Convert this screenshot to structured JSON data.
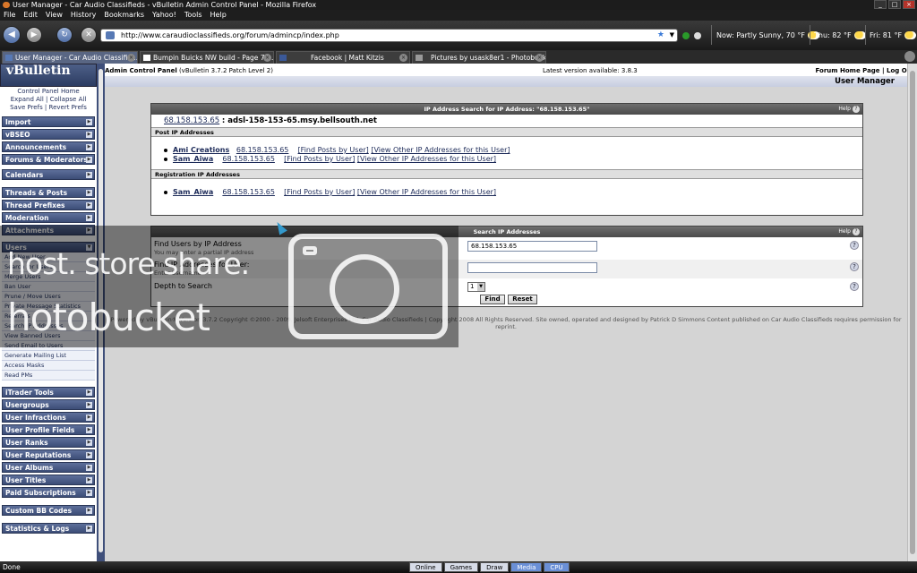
{
  "window": {
    "title": "User Manager - Car Audio Classifieds - vBulletin Admin Control Panel - Mozilla Firefox"
  },
  "menu": [
    "File",
    "Edit",
    "View",
    "History",
    "Bookmarks",
    "Yahoo!",
    "Tools",
    "Help"
  ],
  "url": "http://www.caraudioclassifieds.org/forum/admincp/index.php",
  "weather": {
    "now": "Now: Partly Sunny, 70 °F",
    "thu": "Thu: 82 °F",
    "fri": "Fri: 81 °F"
  },
  "tabs": [
    {
      "label": "User Manager - Car Audio Classifie...",
      "active": true
    },
    {
      "label": "Bumpin Buicks NW build - Page 7 -...",
      "active": false
    },
    {
      "label": "Facebook | Matt Kitzis",
      "active": false
    },
    {
      "label": "Pictures by usask8er1 - Photobucket",
      "active": false
    }
  ],
  "sidebar": {
    "logo": "vBulletin",
    "links": [
      "Control Panel Home",
      "Expand All | Collapse All",
      "Save Prefs | Revert Prefs"
    ],
    "groups_top": [
      "Import",
      "vBSEO",
      "Announcements",
      "Forums & Moderators",
      "Calendars",
      "Threads & Posts",
      "Thread Prefixes",
      "Moderation",
      "Attachments"
    ],
    "users_group": "Users",
    "users_items": [
      "Add New User",
      "Search for Users",
      "Merge Users",
      "Ban User",
      "Prune / Move Users",
      "Private Message Statistics",
      "Referrals",
      "Search IP Addresses",
      "View Banned Users",
      "Send Email to Users",
      "Generate Mailing List",
      "Access Masks",
      "Read PMs"
    ],
    "groups_bottom": [
      "iTrader Tools",
      "Usergroups",
      "User Infractions",
      "User Profile Fields",
      "User Ranks",
      "User Reputations",
      "User Albums",
      "User Titles",
      "Paid Subscriptions",
      "Custom BB Codes",
      "Statistics & Logs"
    ]
  },
  "header": {
    "acp": "Admin Control Panel",
    "version": "(vBulletin 3.7.2 Patch Level 2)",
    "latest": "Latest version available: 3.8.3",
    "links": "Forum Home Page | Log Out",
    "page_title": "User Manager"
  },
  "ip_search": {
    "title": "IP Address Search for IP Address: \"68.158.153.65\"",
    "help": "Help",
    "ip": "68.158.153.65",
    "host": ": adsl-158-153-65.msy.bellsouth.net",
    "post_header": "Post IP Addresses",
    "post_rows": [
      {
        "user": "Ami Creations",
        "ip": "68.158.153.65",
        "find": "[Find Posts by User]",
        "other": "[View Other IP Addresses for this User]"
      },
      {
        "user": "Sam_Aiwa",
        "ip": "68.158.153.65",
        "find": "[Find Posts by User]",
        "other": "[View Other IP Addresses for this User]"
      }
    ],
    "reg_header": "Registration IP Addresses",
    "reg_rows": [
      {
        "user": "Sam_Aiwa",
        "ip": "68.158.153.65",
        "find": "[Find Posts by User]",
        "other": "[View Other IP Addresses for this User]"
      }
    ]
  },
  "search_form": {
    "title": "Search IP Addresses",
    "help": "Help",
    "find_label": "Find Users by IP Address",
    "find_desc": "You may enter a partial IP address",
    "find_value": "68.158.153.65",
    "user_label": "Find IP Addresses for User:",
    "user_desc": "Enter Username",
    "user_value": "",
    "depth_label": "Depth to Search",
    "depth_value": "1",
    "find_btn": "Find",
    "reset_btn": "Reset"
  },
  "copyright": "Powered by vBulletin® Version 3.7.2 Copyright ©2000 - 2009, Jelsoft Enterprises Ltd. Car Audio Classifieds | Copyright 2008 All Rights Reserved. Site owned, operated and designed by Patrick D Simmons Content published on Car Audio Classifieds requires permission for reprint.",
  "watermark": {
    "line1": "host. store share.",
    "line2": "hotobucket"
  },
  "status": "Done",
  "dock": [
    "Online",
    "Games",
    "Draw",
    "Media",
    "CPU"
  ]
}
